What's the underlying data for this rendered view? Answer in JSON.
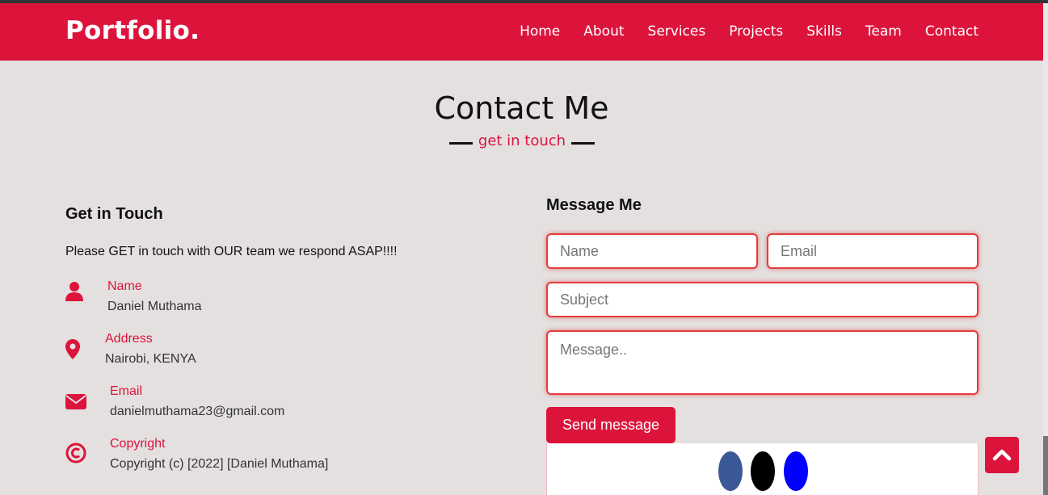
{
  "nav": {
    "logo": "Portfolio.",
    "links": [
      "Home",
      "About",
      "Services",
      "Projects",
      "Skills",
      "Team",
      "Contact"
    ]
  },
  "section": {
    "title": "Contact Me",
    "subtitle": "get in touch"
  },
  "get_in_touch": {
    "title": "Get in Touch",
    "intro": "Please GET in touch with OUR team we respond ASAP!!!!",
    "items": [
      {
        "icon": "user-icon",
        "label": "Name",
        "value": "Daniel Muthama"
      },
      {
        "icon": "map-pin-icon",
        "label": "Address",
        "value": "Nairobi, KENYA"
      },
      {
        "icon": "envelope-icon",
        "label": "Email",
        "value": "danielmuthama23@gmail.com"
      },
      {
        "icon": "copyright-icon",
        "label": "Copyright",
        "value": "Copyright (c) [2022] [Daniel Muthama]"
      }
    ]
  },
  "form": {
    "title": "Message Me",
    "name_placeholder": "Name",
    "email_placeholder": "Email",
    "subject_placeholder": "Subject",
    "message_placeholder": "Message..",
    "send_label": "Send message"
  },
  "social": {
    "colors": [
      "#3b5998",
      "#000000",
      "#0000ff"
    ]
  },
  "colors": {
    "accent": "#dc143c",
    "background": "#e4e0e0"
  }
}
